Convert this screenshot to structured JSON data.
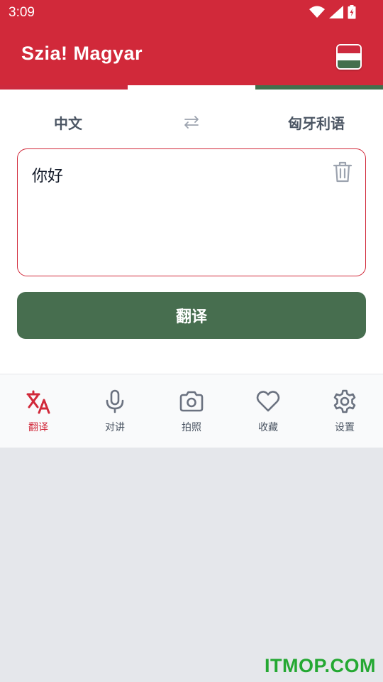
{
  "status_bar": {
    "time": "3:09"
  },
  "app_bar": {
    "title": "Szia! Magyar",
    "flag_colors": [
      "#cd2a3e",
      "#ffffff",
      "#436f4d"
    ]
  },
  "tricolor": [
    "#cd2a3e",
    "#ffffff",
    "#436f4d"
  ],
  "languages": {
    "source": "中文",
    "target": "匈牙利语",
    "swap_icon": "swap-arrows-icon"
  },
  "input": {
    "value": "你好",
    "clear_icon": "trash-icon"
  },
  "translate_button": {
    "label": "翻译"
  },
  "bottom_nav": {
    "items": [
      {
        "label": "翻译",
        "icon": "translate-icon",
        "active": true
      },
      {
        "label": "对讲",
        "icon": "microphone-icon",
        "active": false
      },
      {
        "label": "拍照",
        "icon": "camera-icon",
        "active": false
      },
      {
        "label": "收藏",
        "icon": "heart-icon",
        "active": false
      },
      {
        "label": "设置",
        "icon": "gear-icon",
        "active": false
      }
    ]
  },
  "colors": {
    "primary": "#d1293a",
    "accent_green": "#476e4f",
    "text_gray": "#4b5563"
  },
  "watermark": "ITMOP.COM"
}
